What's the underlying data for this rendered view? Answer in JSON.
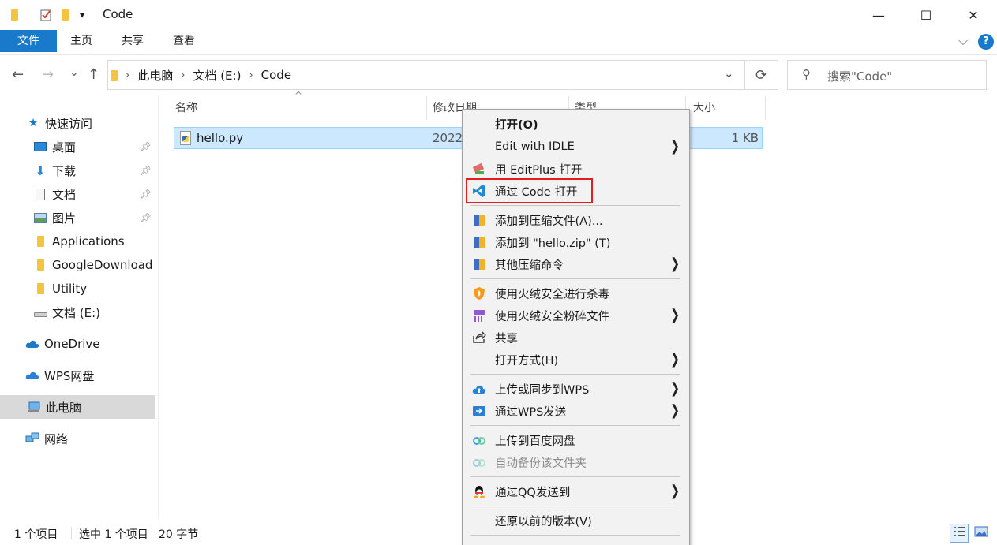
{
  "window": {
    "title": "Code",
    "qa_dropdown": "▾",
    "minimize": "—",
    "maximize": "☐",
    "close": "✕"
  },
  "ribbon": {
    "tabs": [
      "文件",
      "主页",
      "共享",
      "查看"
    ],
    "collapse_arrow": "⌵",
    "help": "?"
  },
  "nav": {
    "back": "←",
    "forward": "→",
    "recent": "⌄",
    "up": "↑",
    "breadcrumb": [
      "此电脑",
      "文档 (E:)",
      "Code"
    ],
    "crumb_sep": "›",
    "dropdown": "⌄",
    "refresh": "⟳",
    "search_placeholder": "搜索\"Code\""
  },
  "sidebar": {
    "items": [
      {
        "label": "快速访问",
        "icon": "star-icon"
      },
      {
        "label": "桌面",
        "icon": "desktop-icon",
        "pinned": true
      },
      {
        "label": "下载",
        "icon": "download-icon",
        "pinned": true
      },
      {
        "label": "文档",
        "icon": "document-icon",
        "pinned": true
      },
      {
        "label": "图片",
        "icon": "picture-icon",
        "pinned": true
      },
      {
        "label": "Applications",
        "icon": "folder-icon"
      },
      {
        "label": "GoogleDownload",
        "icon": "folder-icon"
      },
      {
        "label": "Utility",
        "icon": "folder-icon"
      },
      {
        "label": "文档 (E:)",
        "icon": "drive-icon"
      },
      {
        "label": "OneDrive",
        "icon": "onedrive-icon"
      },
      {
        "label": "WPS网盘",
        "icon": "cloud-icon"
      },
      {
        "label": "此电脑",
        "icon": "computer-icon",
        "selected": true
      },
      {
        "label": "网络",
        "icon": "network-icon"
      }
    ]
  },
  "filelist": {
    "sort_indicator": "^",
    "columns": [
      "名称",
      "修改日期",
      "类型",
      "大小"
    ],
    "rows": [
      {
        "name": "hello.py",
        "modified": "2022",
        "size": "1 KB"
      }
    ]
  },
  "context_menu": {
    "items": [
      {
        "label": "打开(O)",
        "bold": true
      },
      {
        "label": "Edit with IDLE",
        "submenu": true
      },
      {
        "label": "用 EditPlus 打开"
      },
      {
        "label": "通过 Code 打开"
      },
      {
        "label": "添加到压缩文件(A)..."
      },
      {
        "label": "添加到 \"hello.zip\" (T)"
      },
      {
        "label": "其他压缩命令",
        "submenu": true
      },
      {
        "label": "使用火绒安全进行杀毒"
      },
      {
        "label": "使用火绒安全粉碎文件",
        "submenu": true
      },
      {
        "label": "共享"
      },
      {
        "label": "打开方式(H)",
        "submenu": true
      },
      {
        "label": "上传或同步到WPS",
        "submenu": true
      },
      {
        "label": "通过WPS发送",
        "submenu": true
      },
      {
        "label": "上传到百度网盘"
      },
      {
        "label": "自动备份该文件夹",
        "disabled": true
      },
      {
        "label": "通过QQ发送到",
        "submenu": true
      },
      {
        "label": "还原以前的版本(V)"
      }
    ],
    "submenu_arrow": "❯"
  },
  "status": {
    "count": "1 个项目",
    "selected": "选中 1 个项目",
    "size": "20 字节"
  },
  "colors": {
    "accent": "#1979ca",
    "selection": "#cce8ff",
    "highlight_box": "#e41c1c"
  }
}
